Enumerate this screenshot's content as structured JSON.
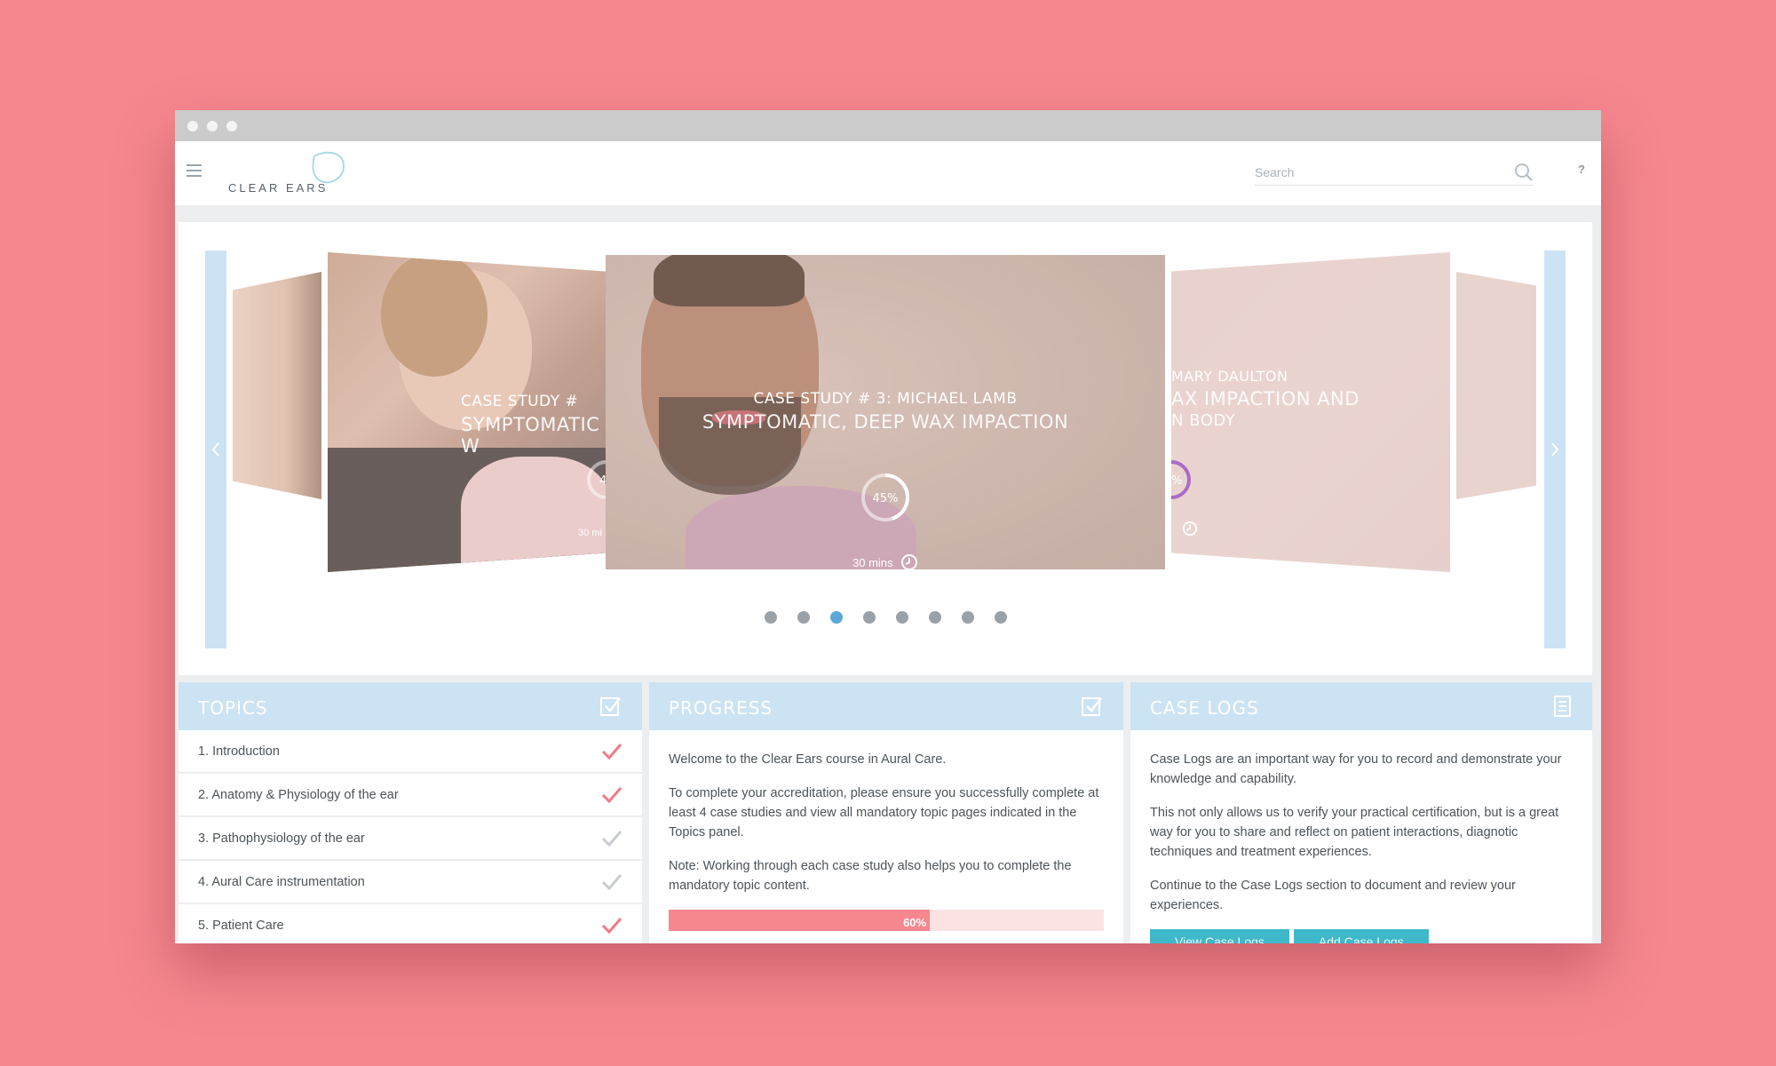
{
  "app": {
    "logo_text": "CLEAR EARS",
    "search_placeholder": "Search",
    "help_label": "?"
  },
  "carousel": {
    "main": {
      "label": "CASE STUDY # 3: MICHAEL LAMB",
      "subtitle": "SYMPTOMATIC, DEEP WAX IMPACTION",
      "progress_label": "45%",
      "progress": 0.45,
      "duration": "30 mins"
    },
    "left": {
      "label": "CASE STUDY #",
      "subtitle": "SYMPTOMATIC W",
      "progress_label": "45",
      "duration": "30 mi"
    },
    "right": {
      "label": "MARY DAULTON",
      "subtitle": "AX IMPACTION AND",
      "subtitle2": "N BODY",
      "progress_label": "%"
    },
    "dot_count": 8,
    "active_dot": 2
  },
  "topics": {
    "title": "TOPICS",
    "items": [
      {
        "label": "1. Introduction",
        "done": true
      },
      {
        "label": "2. Anatomy & Physiology of the ear",
        "done": true
      },
      {
        "label": "3. Pathophysiology of the ear",
        "done": false
      },
      {
        "label": "4. Aural Care instrumentation",
        "done": false
      },
      {
        "label": "5. Patient Care",
        "done": true
      }
    ]
  },
  "progress": {
    "title": "PROGRESS",
    "p1": "Welcome to the Clear Ears course in Aural Care.",
    "p2": "To complete your accreditation, please ensure you successfully complete at least 4 case studies and view all mandatory topic pages indicated in the Topics panel.",
    "p3": "Note: Working through each case study also helps you to complete the mandatory topic content.",
    "bar_label": "60%",
    "bar_value": 0.6
  },
  "caselogs": {
    "title": "CASE LOGS",
    "p1": "Case Logs are an important way for you to record and demonstrate your knowledge and capability.",
    "p2": "This not only allows us to verify your practical certification, but is a great way for you to share and reflect on patient interactions, diagnotic techniques and treatment experiences.",
    "p3": "Continue to the Case Logs section to document and review your experiences.",
    "btn_view": "View Case Logs",
    "btn_add": "Add Case Logs"
  },
  "colors": {
    "background": "#f6878f",
    "panel_header": "#cce3f4",
    "check_done": "#f07a85",
    "check_pending": "#c9cdd1",
    "dot_active": "#5ba8d8",
    "button": "#3fb8c9"
  }
}
